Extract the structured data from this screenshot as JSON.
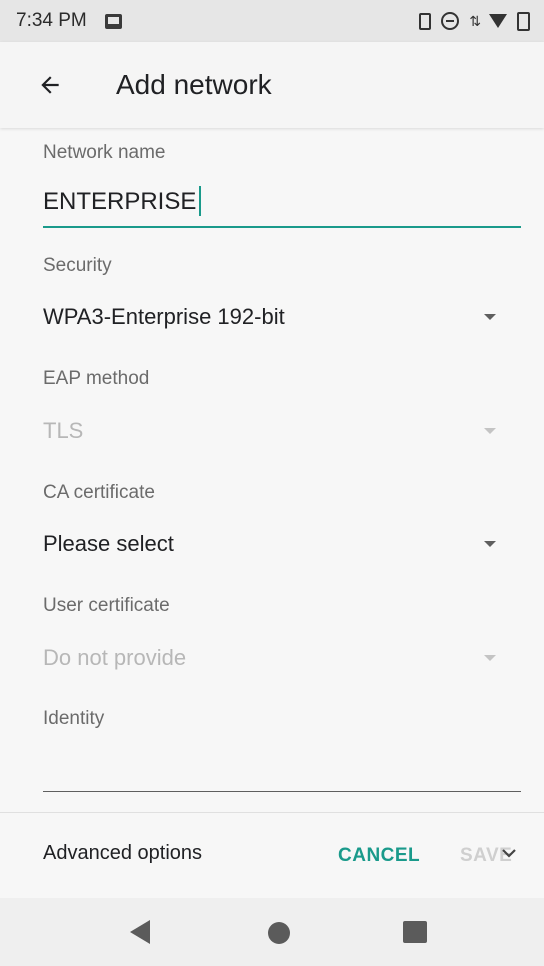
{
  "status_bar": {
    "time": "7:34 PM",
    "icons": [
      "image-icon",
      "vibrate-icon",
      "do-not-disturb-icon",
      "data-arrows-icon",
      "wifi-icon",
      "battery-icon"
    ]
  },
  "app_bar": {
    "title": "Add network",
    "back_icon": "arrow-left-icon"
  },
  "form": {
    "network_name": {
      "label": "Network name",
      "value": "ENTERPRISE"
    },
    "security": {
      "label": "Security",
      "value": "WPA3-Enterprise 192-bit"
    },
    "eap_method": {
      "label": "EAP method",
      "value": "TLS",
      "disabled": true
    },
    "ca_certificate": {
      "label": "CA certificate",
      "value": "Please select"
    },
    "user_certificate": {
      "label": "User certificate",
      "value": "Do not provide",
      "disabled": true
    },
    "identity": {
      "label": "Identity",
      "value": ""
    }
  },
  "actions": {
    "advanced_options": "Advanced options",
    "cancel": "CANCEL",
    "save": "SAVE"
  },
  "colors": {
    "accent": "#1a9a8b",
    "disabled_text": "#b7b7b7",
    "label_text": "#6b6b6b"
  },
  "nav_bar": {
    "icons": [
      "back-triangle-icon",
      "home-circle-icon",
      "recents-square-icon"
    ]
  }
}
